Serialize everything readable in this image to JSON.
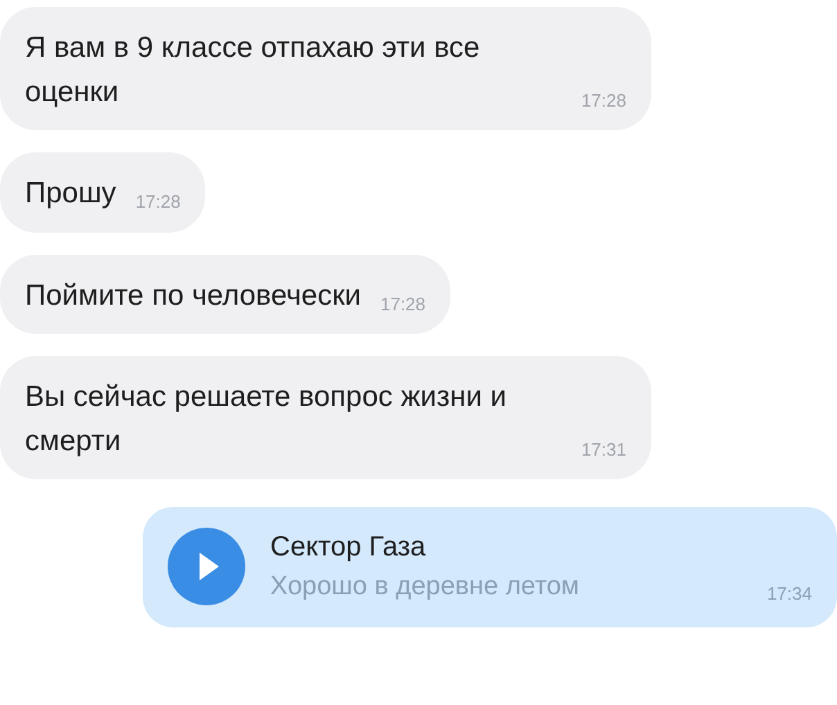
{
  "messages": [
    {
      "kind": "text",
      "text": "Я вам в 9 классе отпахаю эти все оценки",
      "time": "17:28"
    },
    {
      "kind": "text",
      "text": "Прошу",
      "time": "17:28"
    },
    {
      "kind": "text",
      "text": "Поймите по человечески",
      "time": "17:28"
    },
    {
      "kind": "text",
      "text": "Вы сейчас решаете вопрос жизни и смерти",
      "time": "17:31"
    },
    {
      "kind": "audio",
      "title": "Сектор Газа",
      "subtitle": "Хорошо в деревне летом",
      "time": "17:34"
    }
  ]
}
